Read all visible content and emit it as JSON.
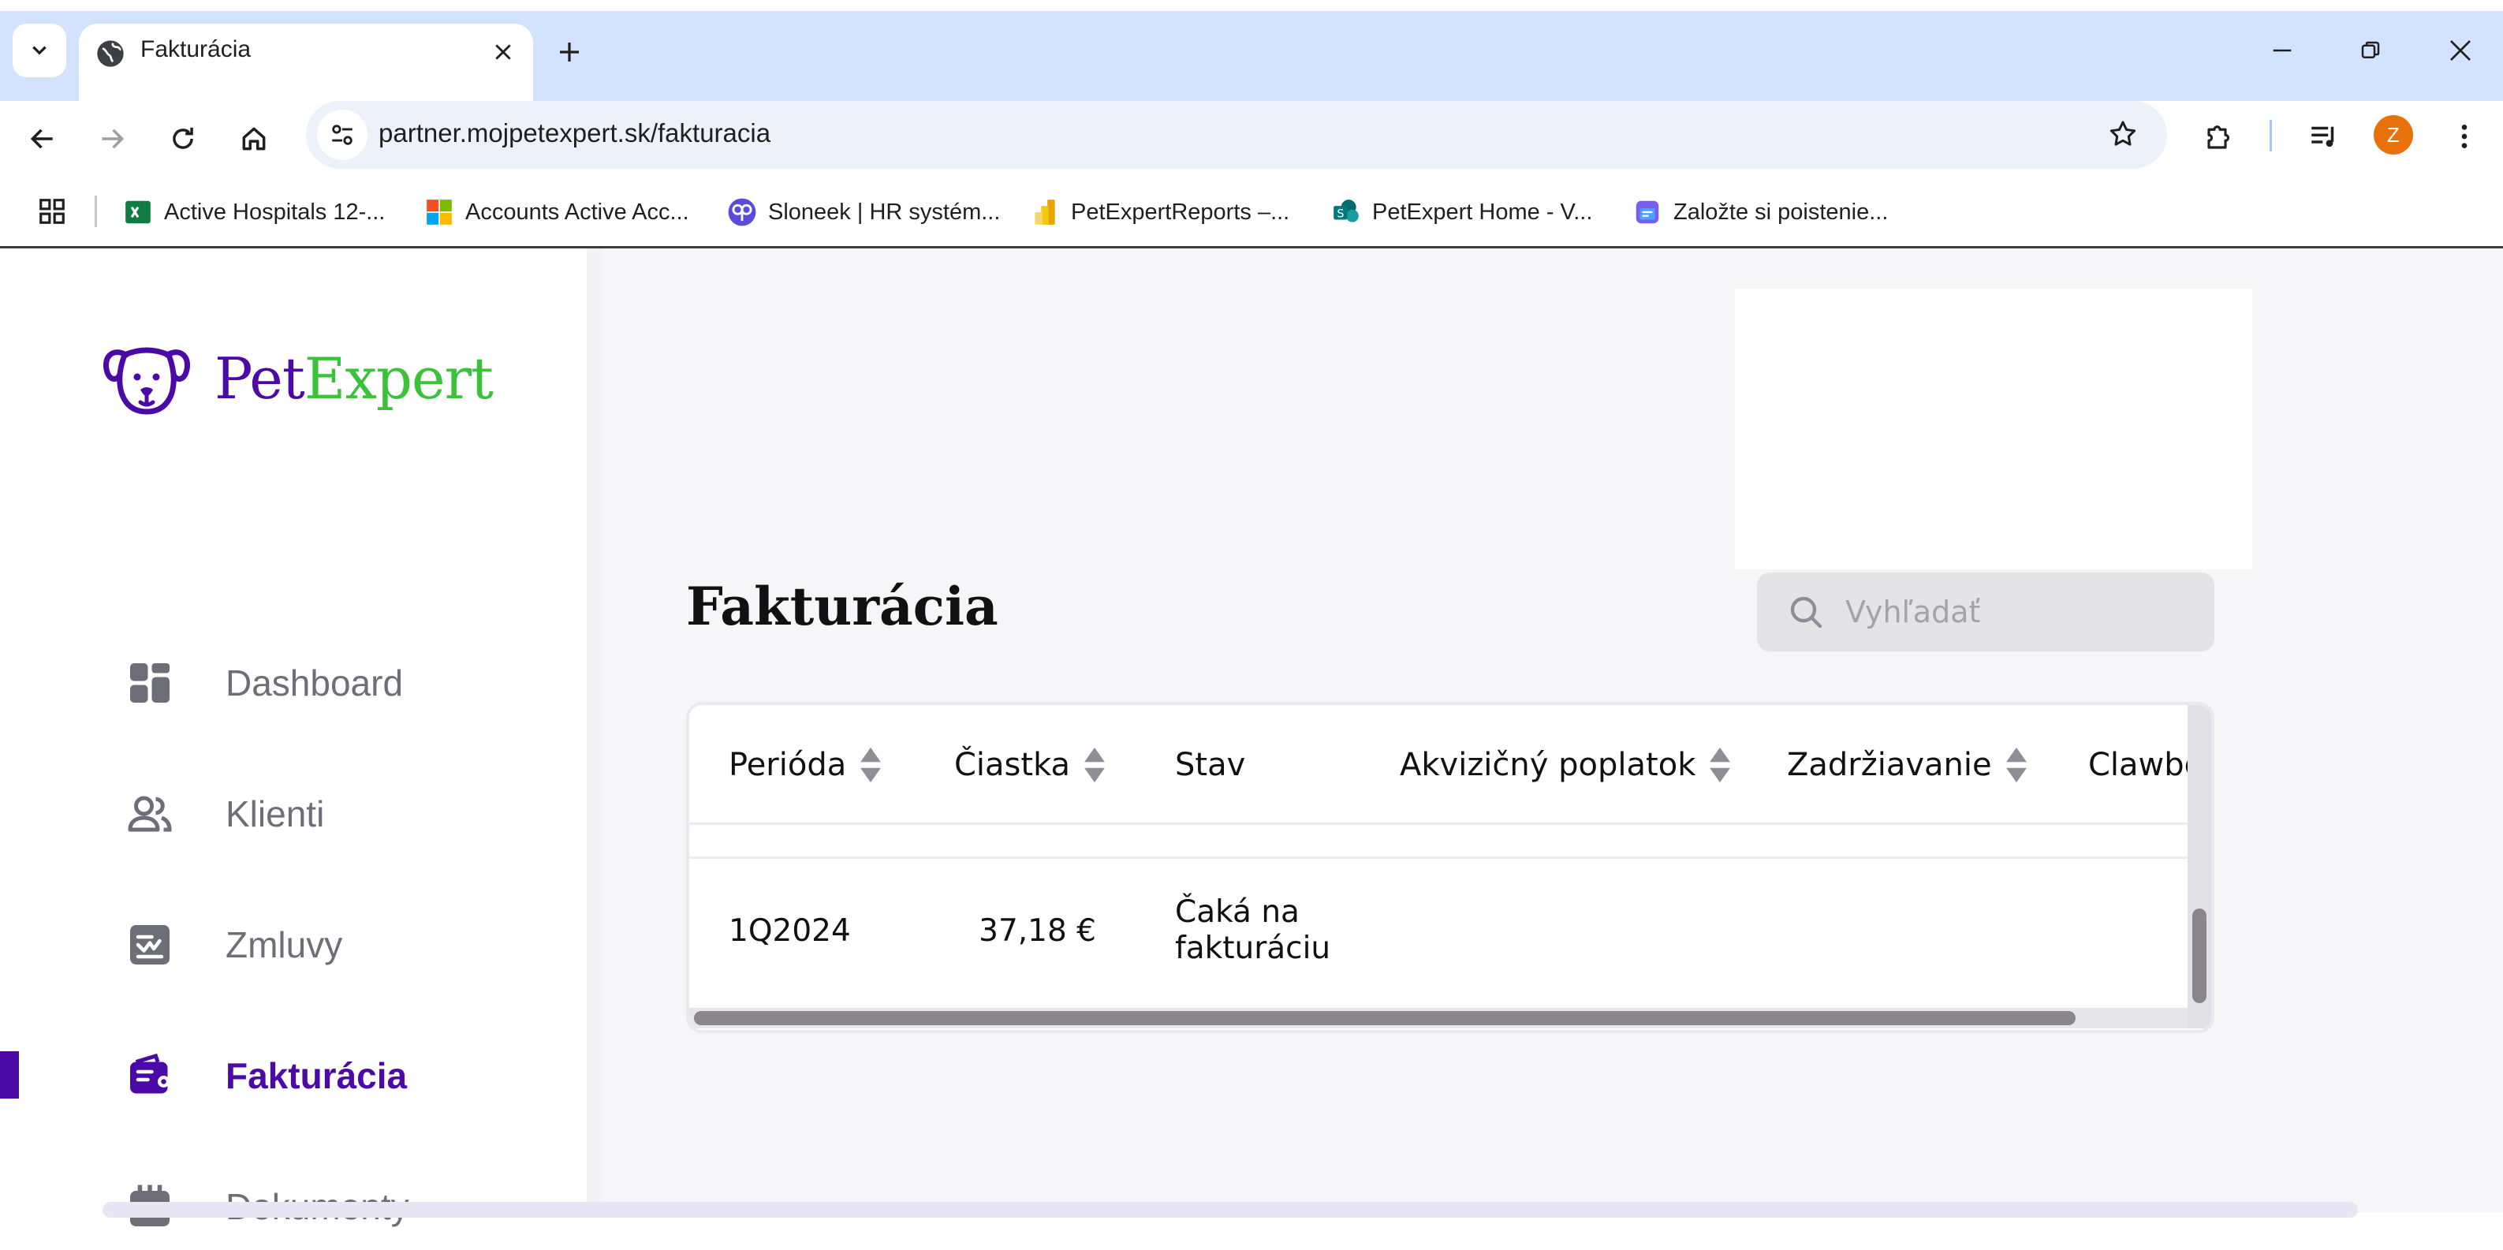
{
  "browser": {
    "tab_title": "Fakturácia",
    "url": "partner.mojpetexpert.sk/fakturacia",
    "avatar_letter": "Z",
    "accent_color": "#d3e3fd",
    "bookmarks": [
      {
        "label": "Active Hospitals 12-...",
        "icon": "excel-icon"
      },
      {
        "label": "Accounts Active Acc...",
        "icon": "microsoft-icon"
      },
      {
        "label": "Sloneek | HR systém...",
        "icon": "sloneek-icon"
      },
      {
        "label": "PetExpertReports –...",
        "icon": "powerbi-icon"
      },
      {
        "label": "PetExpert Home - V...",
        "icon": "sharepoint-icon"
      },
      {
        "label": "Založte si poistenie...",
        "icon": "form-icon"
      }
    ]
  },
  "brand": {
    "pet": "Pet",
    "expert": "Expert",
    "primary_color": "#4b0aa8",
    "secondary_color": "#3cc13b"
  },
  "sidebar": {
    "items": [
      {
        "label": "Dashboard",
        "icon": "dashboard-icon",
        "active": false
      },
      {
        "label": "Klienti",
        "icon": "users-icon",
        "active": false
      },
      {
        "label": "Zmluvy",
        "icon": "contract-icon",
        "active": false
      },
      {
        "label": "Fakturácia",
        "icon": "wallet-icon",
        "active": true
      },
      {
        "label": "Dokumenty",
        "icon": "calendar-icon",
        "active": false
      }
    ]
  },
  "main": {
    "title": "Fakturácia",
    "search_placeholder": "Vyhľadať",
    "table": {
      "columns": [
        "Perióda",
        "Čiastka",
        "Stav",
        "Akvizičný poplatok",
        "Zadržiavanie",
        "Clawbc"
      ],
      "rows": [
        {
          "period": "1Q2024",
          "amount": "37,18 €",
          "status_line1": "Čaká na",
          "status_line2": "fakturáciu"
        }
      ]
    }
  }
}
